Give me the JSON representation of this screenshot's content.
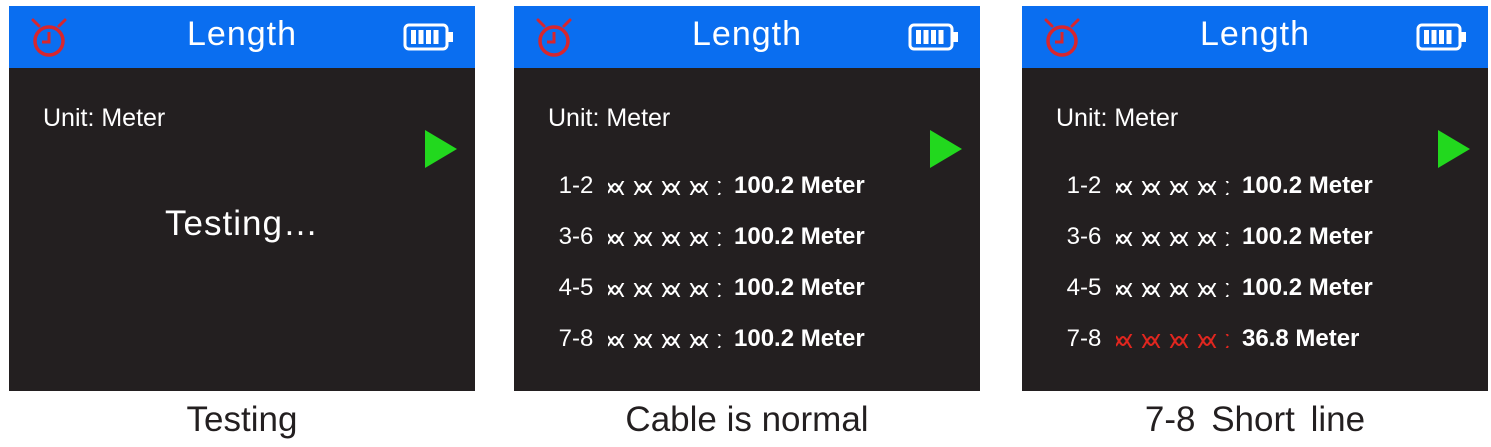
{
  "colors": {
    "header_blue": "#0a6ef0",
    "screen_bg": "#231f20",
    "timer_red": "#d7262e",
    "play_green": "#22d81e",
    "fault_red": "#e0261f",
    "text_white": "#ffffff"
  },
  "icons": {
    "timer": "timer-icon",
    "battery": "battery-icon",
    "play": "play-icon",
    "twisted_pair": "twisted-pair-icon"
  },
  "panels": [
    {
      "title": "Length",
      "unit": "Unit: Meter",
      "testing": "Testing…",
      "caption": "Testing"
    },
    {
      "title": "Length",
      "unit": "Unit: Meter",
      "rows": [
        {
          "pair": "1-2",
          "value": "100.2 Meter",
          "status": "normal"
        },
        {
          "pair": "3-6",
          "value": "100.2 Meter",
          "status": "normal"
        },
        {
          "pair": "4-5",
          "value": "100.2 Meter",
          "status": "normal"
        },
        {
          "pair": "7-8",
          "value": "100.2 Meter",
          "status": "normal"
        }
      ],
      "caption": "Cable is normal"
    },
    {
      "title": "Length",
      "unit": "Unit: Meter",
      "rows": [
        {
          "pair": "1-2",
          "value": "100.2 Meter",
          "status": "normal"
        },
        {
          "pair": "3-6",
          "value": "100.2 Meter",
          "status": "normal"
        },
        {
          "pair": "4-5",
          "value": "100.2 Meter",
          "status": "normal"
        },
        {
          "pair": "7-8",
          "value": "36.8 Meter",
          "status": "short"
        }
      ],
      "caption": "7-8 Short line"
    }
  ]
}
